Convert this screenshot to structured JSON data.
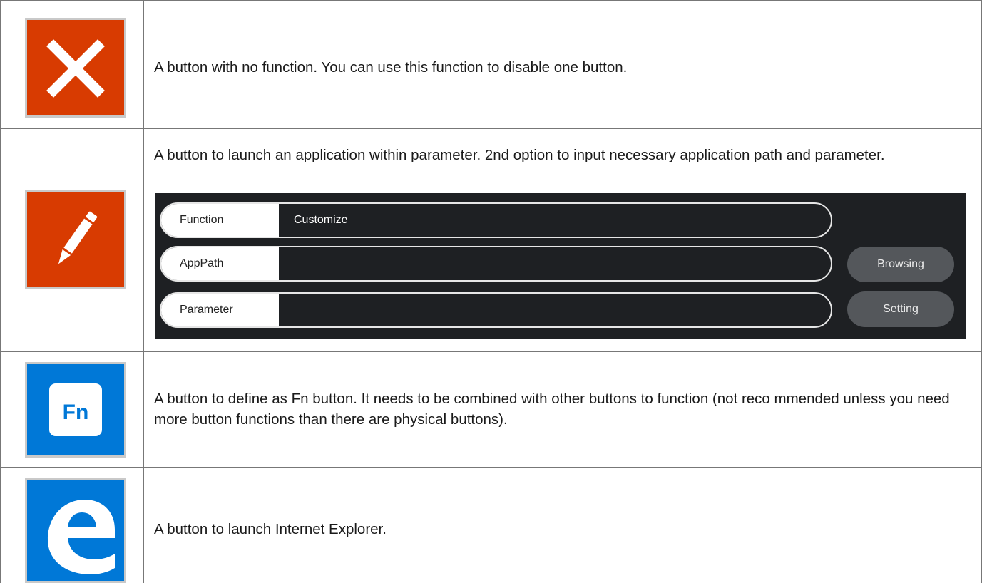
{
  "rows": [
    {
      "icon": "x-icon",
      "description": "A button with no function. You can use this function to disable one button."
    },
    {
      "icon": "pencil-icon",
      "description": "A button to launch an application within parameter. 2nd option to input necessary application path and parameter."
    },
    {
      "icon": "fn-key-icon",
      "icon_text": "Fn",
      "description": "A button to define as Fn button. It needs to be combined with other buttons to function (not reco mmended unless you need more button functions than there are physical buttons)."
    },
    {
      "icon": "edge-browser-icon",
      "description": "A button to launch Internet Explorer."
    }
  ],
  "panel": {
    "function_label": "Function",
    "function_value": "Customize",
    "apppath_label": "AppPath",
    "apppath_value": "",
    "parameter_label": "Parameter",
    "parameter_value": "",
    "browsing_button": "Browsing",
    "setting_button": "Setting"
  },
  "colors": {
    "red_tile": "#d83b01",
    "blue_tile": "#0078d7",
    "panel_bg": "#1e2023",
    "dark_button": "#54575b"
  }
}
